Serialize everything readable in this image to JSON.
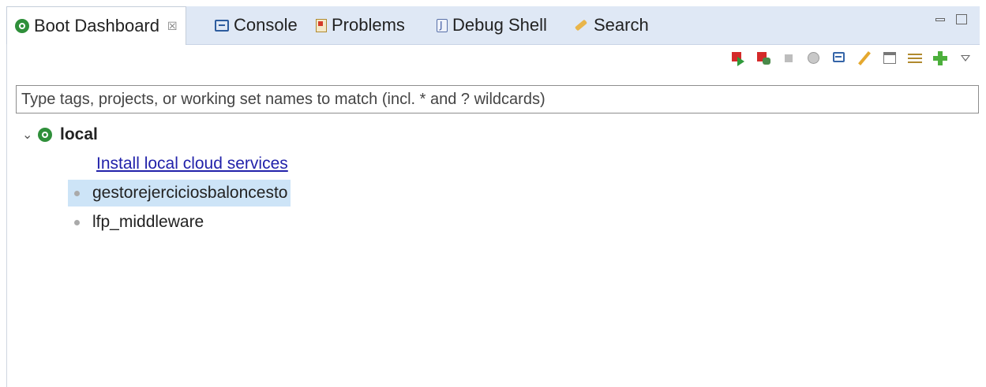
{
  "tabs": [
    {
      "label": "Boot Dashboard",
      "icon": "spring-boot-icon",
      "active": true,
      "close_symbol": "☒"
    },
    {
      "label": "Console",
      "icon": "console-icon"
    },
    {
      "label": "Problems",
      "icon": "problems-icon"
    },
    {
      "label": "Debug Shell",
      "icon": "debug-shell-icon"
    },
    {
      "label": "Search",
      "icon": "search-icon"
    }
  ],
  "toolbar": [
    "start-icon",
    "debug-icon",
    "stop-icon",
    "open-browser-icon",
    "open-console-icon",
    "edit-icon",
    "properties-icon",
    "filter-icon",
    "add-target-icon",
    "view-menu-icon"
  ],
  "filter": {
    "placeholder": "Type tags, projects, or working set names to match (incl. * and ? wildcards)",
    "value": ""
  },
  "tree": {
    "root": {
      "label": "local",
      "expanded": true,
      "icon": "spring-boot-icon"
    },
    "link": "Install local cloud services",
    "apps": [
      {
        "name": "gestorejerciciosbaloncesto",
        "selected": true
      },
      {
        "name": "lfp_middleware",
        "selected": false
      }
    ]
  },
  "colors": {
    "tab_bar": "#dfe8f5",
    "selection": "#cde4f7",
    "link": "#2222aa",
    "boot_green": "#2f8f3a"
  }
}
